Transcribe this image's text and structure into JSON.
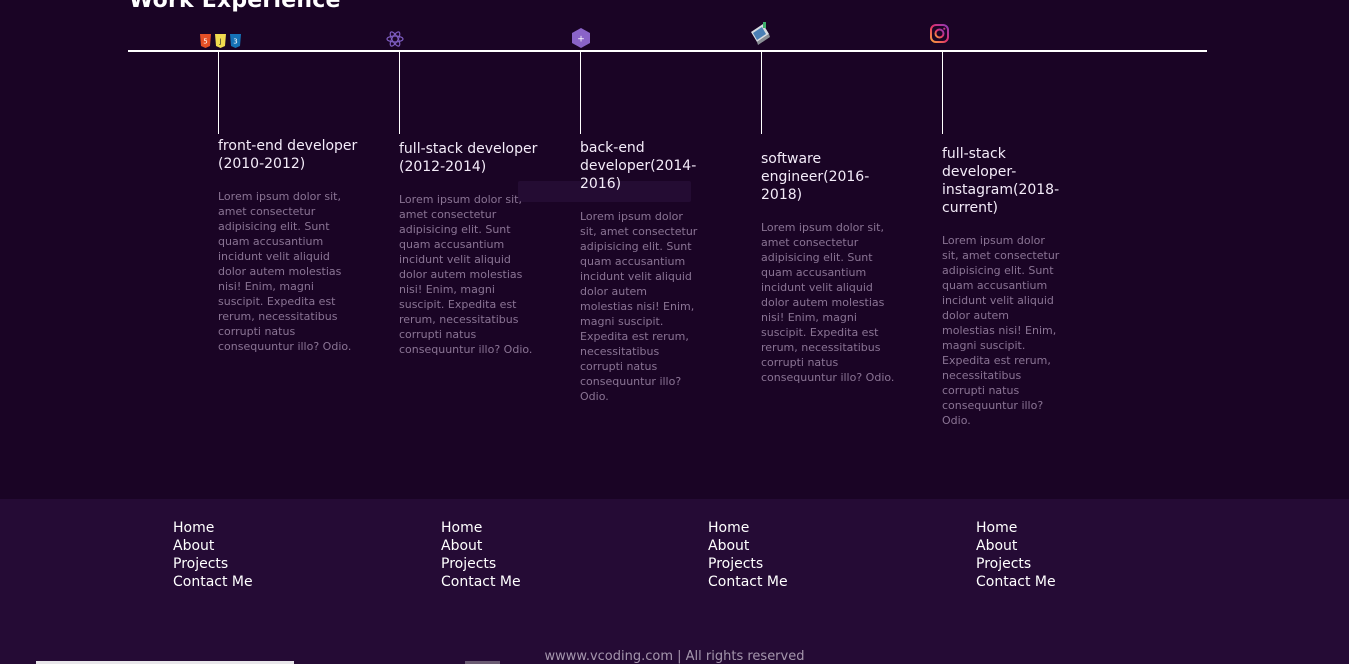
{
  "section_title": "Work Experience",
  "timeline": [
    {
      "icon": "html-css-js-icon",
      "role": "front-end developer (2010-2012)",
      "description": "Lorem ipsum dolor sit, amet consectetur adipisicing elit. Sunt quam accusantium incidunt velit aliquid dolor autem molestias nisi! Enim, magni suscipit. Expedita est rerum, necessitatibus corrupti natus consequuntur illo? Odio."
    },
    {
      "icon": "react-icon",
      "role": "full-stack developer (2012-2014)",
      "description": "Lorem ipsum dolor sit, amet consectetur adipisicing elit. Sunt quam accusantium incidunt velit aliquid dolor autem molestias nisi! Enim, magni suscipit. Expedita est rerum, necessitatibus corrupti natus consequuntur illo? Odio."
    },
    {
      "icon": "php-icon",
      "role": "back-end developer(2014-2016)",
      "description": "Lorem ipsum dolor sit, amet consectetur adipisicing elit. Sunt quam accusantium incidunt velit aliquid dolor autem molestias nisi! Enim, magni suscipit. Expedita est rerum, necessitatibus corrupti natus consequuntur illo? Odio."
    },
    {
      "icon": "software-icon",
      "role": "software engineer(2016-2018)",
      "description": "Lorem ipsum dolor sit, amet consectetur adipisicing elit. Sunt quam accusantium incidunt velit aliquid dolor autem molestias nisi! Enim, magni suscipit. Expedita est rerum, necessitatibus corrupti natus consequuntur illo? Odio."
    },
    {
      "icon": "instagram-icon",
      "role": "full-stack developer-instagram(2018-current)",
      "description": "Lorem ipsum dolor sit, amet consectetur adipisicing elit. Sunt quam accusantium incidunt velit aliquid dolor autem molestias nisi! Enim, magni suscipit. Expedita est rerum, necessitatibus corrupti natus consequuntur illo? Odio."
    }
  ],
  "footer": {
    "columns": [
      {
        "links": [
          "Home",
          "About",
          "Projects",
          "Contact Me"
        ]
      },
      {
        "links": [
          "Home",
          "About",
          "Projects",
          "Contact Me"
        ]
      },
      {
        "links": [
          "Home",
          "About",
          "Projects",
          "Contact Me"
        ]
      },
      {
        "links": [
          "Home",
          "About",
          "Projects",
          "Contact Me"
        ]
      }
    ],
    "copyright": "wwww.vcoding.com | All rights reserved"
  },
  "colors": {
    "background": "#1a0425",
    "footer_background": "#250b35",
    "text": "#ffffff",
    "muted_text": "#8a7494"
  }
}
